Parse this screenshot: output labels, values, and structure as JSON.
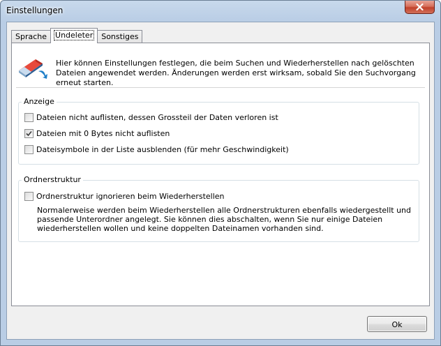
{
  "window": {
    "title": "Einstellungen"
  },
  "tabs": [
    {
      "label": "Sprache",
      "active": false
    },
    {
      "label": "Undeleter",
      "active": true
    },
    {
      "label": "Sonstiges",
      "active": false
    }
  ],
  "header": {
    "icon": "eraser-icon",
    "text": "Hier können Einstellungen festlegen, die beim Suchen und Wiederherstellen nach gelöschten Dateien angewendet werden. Änderungen werden erst wirksam, sobald Sie den Suchvorgang erneut starten."
  },
  "anzeige": {
    "legend": "Anzeige",
    "options": [
      {
        "label": "Dateien nicht auflisten,  dessen Grossteil der Daten verloren ist",
        "checked": false
      },
      {
        "label": "Dateien mit 0 Bytes nicht auflisten",
        "checked": true
      },
      {
        "label": "Dateisymbole in der Liste ausblenden (für mehr Geschwindigkeit)",
        "checked": false
      }
    ]
  },
  "ordnerstruktur": {
    "legend": "Ordnerstruktur",
    "option": {
      "label": "Ordnerstruktur ignorieren beim Wiederherstellen",
      "checked": false
    },
    "description": "Normalerweise werden beim Wiederherstellen alle Ordnerstrukturen ebenfalls wiedergestellt und passende Unterordner angelegt. Sie können dies abschalten, wenn Sie nur einige Dateien wiederherstellen wollen und keine doppelten Dateinamen vorhanden sind."
  },
  "buttons": {
    "ok": "Ok"
  }
}
